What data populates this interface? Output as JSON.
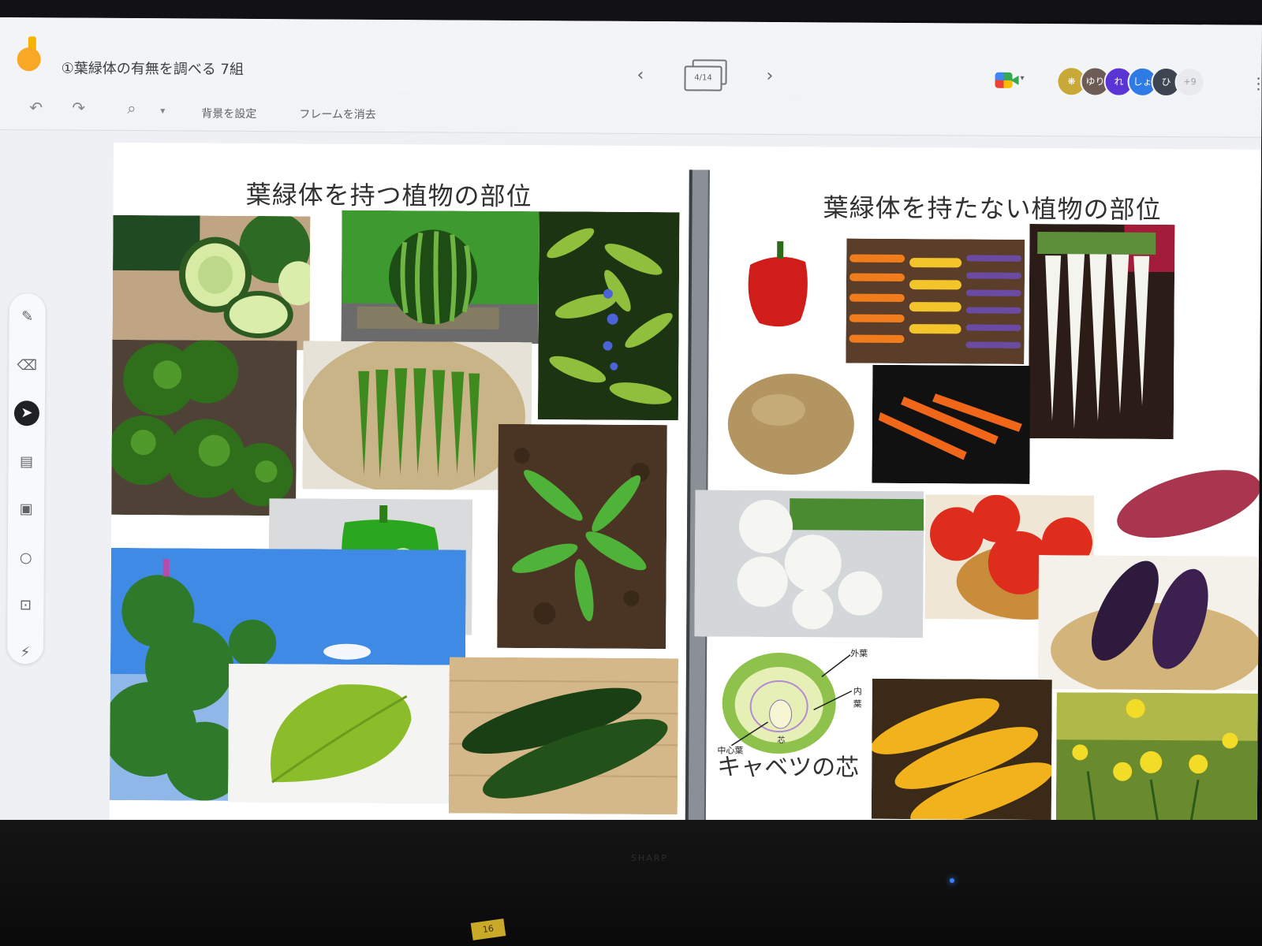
{
  "app": {
    "doc_title": "①葉緑体の有無を調べる 7組",
    "frame_indicator": "4/14",
    "more_participants": "+9"
  },
  "participants": [
    {
      "initial": "",
      "color": "#c8a836"
    },
    {
      "initial": "ゆり",
      "color": "#6d5b55"
    },
    {
      "initial": "れ",
      "color": "#5b34d6"
    },
    {
      "initial": "しょ",
      "color": "#2f7be5"
    },
    {
      "initial": "ひ",
      "color": "#3d4650"
    }
  ],
  "toolbar": {
    "set_background": "背景を設定",
    "clear_frame": "フレームを消去"
  },
  "canvas": {
    "left_heading": "葉緑体を持つ植物の部位",
    "right_heading": "葉緑体を持たない植物の部位",
    "cabbage_label": "キャベツの芯",
    "cabbage_outer_leaf": "外葉",
    "cabbage_inner_leaf": "内葉",
    "cabbage_center_leaf": "中心葉",
    "cabbage_core": "芯"
  },
  "device": {
    "brand": "SHARP",
    "sticker": "16"
  },
  "colors": {
    "accent": "#202124",
    "canvas_bg": "#ffffff",
    "app_bg": "#f3f4f6"
  }
}
